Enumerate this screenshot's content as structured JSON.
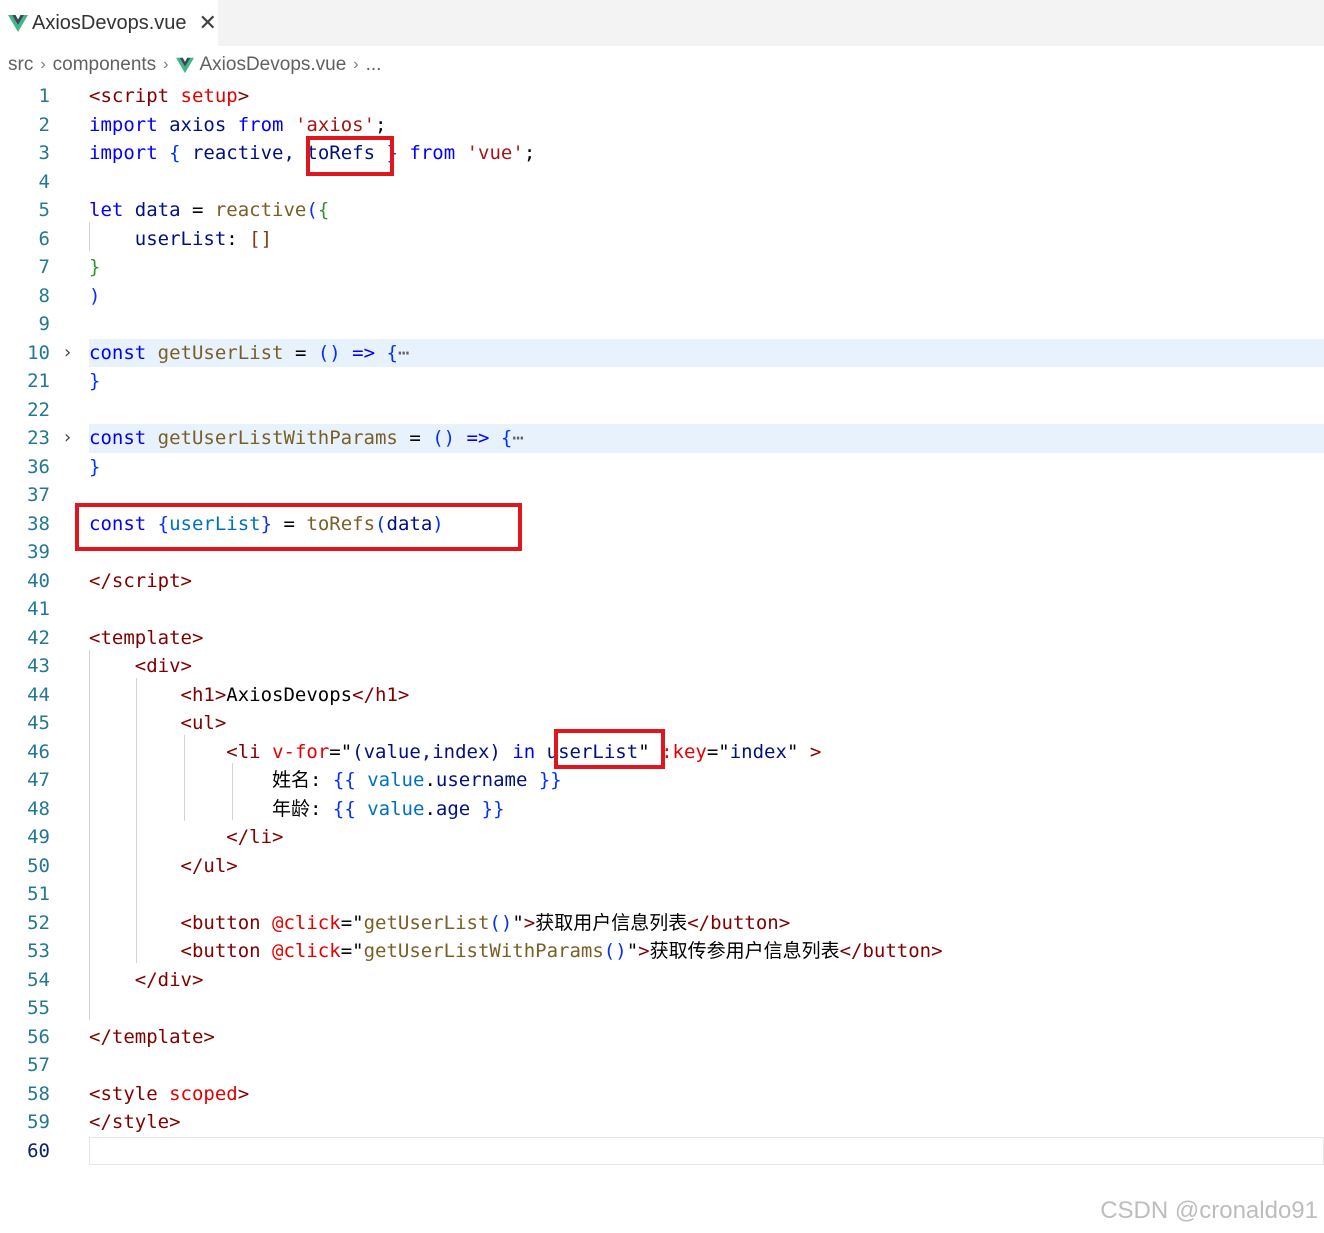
{
  "tab": {
    "label": "AxiosDevops.vue",
    "close": "✕"
  },
  "breadcrumb": {
    "items": [
      "src",
      "components",
      "AxiosDevops.vue",
      "..."
    ]
  },
  "editor": {
    "lines": [
      {
        "n": "1",
        "segs": [
          {
            "t": "<",
            "c": "tag"
          },
          {
            "t": "script",
            "c": "tag"
          },
          {
            "t": " setup",
            "c": "attr"
          },
          {
            "t": ">",
            "c": "tag"
          }
        ]
      },
      {
        "n": "2",
        "segs": [
          {
            "t": "import",
            "c": "kw"
          },
          {
            "t": " axios ",
            "c": "var"
          },
          {
            "t": "from",
            "c": "kw"
          },
          {
            "t": " ",
            "c": "plain"
          },
          {
            "t": "'axios'",
            "c": "str"
          },
          {
            "t": ";",
            "c": "plain"
          }
        ]
      },
      {
        "n": "3",
        "segs": [
          {
            "t": "import",
            "c": "kw"
          },
          {
            "t": " ",
            "c": "plain"
          },
          {
            "t": "{",
            "c": "br1"
          },
          {
            "t": " reactive, ",
            "c": "var"
          },
          {
            "t": "toRefs",
            "c": "var"
          },
          {
            "t": " ",
            "c": "plain"
          },
          {
            "t": "}",
            "c": "br1"
          },
          {
            "t": " ",
            "c": "plain"
          },
          {
            "t": "from",
            "c": "kw"
          },
          {
            "t": " ",
            "c": "plain"
          },
          {
            "t": "'vue'",
            "c": "str"
          },
          {
            "t": ";",
            "c": "plain"
          }
        ]
      },
      {
        "n": "4",
        "segs": []
      },
      {
        "n": "5",
        "segs": [
          {
            "t": "let",
            "c": "kw"
          },
          {
            "t": " data ",
            "c": "var"
          },
          {
            "t": "= ",
            "c": "plain"
          },
          {
            "t": "reactive",
            "c": "fn"
          },
          {
            "t": "(",
            "c": "br1"
          },
          {
            "t": "{",
            "c": "br2"
          }
        ]
      },
      {
        "n": "6",
        "segs": [
          {
            "t": "    userList",
            "c": "var"
          },
          {
            "t": ": ",
            "c": "plain"
          },
          {
            "t": "[]",
            "c": "br3"
          }
        ]
      },
      {
        "n": "7",
        "segs": [
          {
            "t": "}",
            "c": "br2"
          }
        ]
      },
      {
        "n": "8",
        "segs": [
          {
            "t": ")",
            "c": "br1"
          }
        ]
      },
      {
        "n": "9",
        "segs": []
      },
      {
        "n": "10",
        "fold": true,
        "segs": [
          {
            "t": "const",
            "c": "kw"
          },
          {
            "t": " ",
            "c": "plain"
          },
          {
            "t": "getUserList",
            "c": "fn"
          },
          {
            "t": " = ",
            "c": "plain"
          },
          {
            "t": "()",
            "c": "br1"
          },
          {
            "t": " ",
            "c": "plain"
          },
          {
            "t": "=>",
            "c": "kw"
          },
          {
            "t": " ",
            "c": "plain"
          },
          {
            "t": "{",
            "c": "br1"
          },
          {
            "t": "⋯",
            "c": "ell"
          }
        ]
      },
      {
        "n": "21",
        "segs": [
          {
            "t": "}",
            "c": "br1"
          }
        ]
      },
      {
        "n": "22",
        "segs": []
      },
      {
        "n": "23",
        "fold": true,
        "segs": [
          {
            "t": "const",
            "c": "kw"
          },
          {
            "t": " ",
            "c": "plain"
          },
          {
            "t": "getUserListWithParams",
            "c": "fn"
          },
          {
            "t": " = ",
            "c": "plain"
          },
          {
            "t": "()",
            "c": "br1"
          },
          {
            "t": " ",
            "c": "plain"
          },
          {
            "t": "=>",
            "c": "kw"
          },
          {
            "t": " ",
            "c": "plain"
          },
          {
            "t": "{",
            "c": "br1"
          },
          {
            "t": "⋯",
            "c": "ell"
          }
        ]
      },
      {
        "n": "36",
        "segs": [
          {
            "t": "}",
            "c": "br1"
          }
        ]
      },
      {
        "n": "37",
        "segs": []
      },
      {
        "n": "38",
        "segs": [
          {
            "t": "const",
            "c": "kw"
          },
          {
            "t": " ",
            "c": "plain"
          },
          {
            "t": "{",
            "c": "br1"
          },
          {
            "t": "userList",
            "c": "ref"
          },
          {
            "t": "}",
            "c": "br1"
          },
          {
            "t": " = ",
            "c": "plain"
          },
          {
            "t": "toRefs",
            "c": "fn"
          },
          {
            "t": "(",
            "c": "br1"
          },
          {
            "t": "data",
            "c": "var"
          },
          {
            "t": ")",
            "c": "br1"
          }
        ]
      },
      {
        "n": "39",
        "segs": []
      },
      {
        "n": "40",
        "segs": [
          {
            "t": "</",
            "c": "tag"
          },
          {
            "t": "script",
            "c": "tag"
          },
          {
            "t": ">",
            "c": "tag"
          }
        ]
      },
      {
        "n": "41",
        "segs": []
      },
      {
        "n": "42",
        "segs": [
          {
            "t": "<",
            "c": "tag"
          },
          {
            "t": "template",
            "c": "tag"
          },
          {
            "t": ">",
            "c": "tag"
          }
        ]
      },
      {
        "n": "43",
        "segs": [
          {
            "t": "    ",
            "c": "plain"
          },
          {
            "t": "<div>",
            "c": "tag"
          }
        ]
      },
      {
        "n": "44",
        "segs": [
          {
            "t": "        ",
            "c": "plain"
          },
          {
            "t": "<h1>",
            "c": "tag"
          },
          {
            "t": "AxiosDevops",
            "c": "plain"
          },
          {
            "t": "</h1>",
            "c": "tag"
          }
        ]
      },
      {
        "n": "45",
        "segs": [
          {
            "t": "        ",
            "c": "plain"
          },
          {
            "t": "<ul>",
            "c": "tag"
          }
        ]
      },
      {
        "n": "46",
        "segs": [
          {
            "t": "            ",
            "c": "plain"
          },
          {
            "t": "<li",
            "c": "tag"
          },
          {
            "t": " ",
            "c": "plain"
          },
          {
            "t": "v-for",
            "c": "attr"
          },
          {
            "t": "=\"",
            "c": "plain"
          },
          {
            "t": "(value,index)",
            "c": "var"
          },
          {
            "t": " ",
            "c": "plain"
          },
          {
            "t": "in",
            "c": "kw"
          },
          {
            "t": " ",
            "c": "plain"
          },
          {
            "t": "userList",
            "c": "var"
          },
          {
            "t": "\" ",
            "c": "plain"
          },
          {
            "t": ":key",
            "c": "attr"
          },
          {
            "t": "=\"",
            "c": "plain"
          },
          {
            "t": "index",
            "c": "var"
          },
          {
            "t": "\" ",
            "c": "plain"
          },
          {
            "t": ">",
            "c": "tag"
          }
        ]
      },
      {
        "n": "47",
        "segs": [
          {
            "t": "                姓名: ",
            "c": "plain"
          },
          {
            "t": "{{",
            "c": "br1"
          },
          {
            "t": " value",
            "c": "ref"
          },
          {
            "t": ".",
            "c": "plain"
          },
          {
            "t": "username",
            "c": "var"
          },
          {
            "t": " ",
            "c": "plain"
          },
          {
            "t": "}}",
            "c": "br1"
          }
        ]
      },
      {
        "n": "48",
        "segs": [
          {
            "t": "                年龄: ",
            "c": "plain"
          },
          {
            "t": "{{",
            "c": "br1"
          },
          {
            "t": " value",
            "c": "ref"
          },
          {
            "t": ".",
            "c": "plain"
          },
          {
            "t": "age",
            "c": "var"
          },
          {
            "t": " ",
            "c": "plain"
          },
          {
            "t": "}}",
            "c": "br1"
          }
        ]
      },
      {
        "n": "49",
        "segs": [
          {
            "t": "            ",
            "c": "plain"
          },
          {
            "t": "</li>",
            "c": "tag"
          }
        ]
      },
      {
        "n": "50",
        "segs": [
          {
            "t": "        ",
            "c": "plain"
          },
          {
            "t": "</ul>",
            "c": "tag"
          }
        ]
      },
      {
        "n": "51",
        "segs": []
      },
      {
        "n": "52",
        "segs": [
          {
            "t": "        ",
            "c": "plain"
          },
          {
            "t": "<button",
            "c": "tag"
          },
          {
            "t": " ",
            "c": "plain"
          },
          {
            "t": "@click",
            "c": "attr"
          },
          {
            "t": "=\"",
            "c": "plain"
          },
          {
            "t": "getUserList",
            "c": "fn"
          },
          {
            "t": "()",
            "c": "br1"
          },
          {
            "t": "\"",
            "c": "plain"
          },
          {
            "t": ">",
            "c": "tag"
          },
          {
            "t": "获取用户信息列表",
            "c": "plain"
          },
          {
            "t": "</button>",
            "c": "tag"
          }
        ]
      },
      {
        "n": "53",
        "segs": [
          {
            "t": "        ",
            "c": "plain"
          },
          {
            "t": "<button",
            "c": "tag"
          },
          {
            "t": " ",
            "c": "plain"
          },
          {
            "t": "@click",
            "c": "attr"
          },
          {
            "t": "=\"",
            "c": "plain"
          },
          {
            "t": "getUserListWithParams",
            "c": "fn"
          },
          {
            "t": "()",
            "c": "br1"
          },
          {
            "t": "\"",
            "c": "plain"
          },
          {
            "t": ">",
            "c": "tag"
          },
          {
            "t": "获取传参用户信息列表",
            "c": "plain"
          },
          {
            "t": "</button>",
            "c": "tag"
          }
        ]
      },
      {
        "n": "54",
        "segs": [
          {
            "t": "    ",
            "c": "plain"
          },
          {
            "t": "</div>",
            "c": "tag"
          }
        ]
      },
      {
        "n": "55",
        "segs": []
      },
      {
        "n": "56",
        "segs": [
          {
            "t": "</",
            "c": "tag"
          },
          {
            "t": "template",
            "c": "tag"
          },
          {
            "t": ">",
            "c": "tag"
          }
        ]
      },
      {
        "n": "57",
        "segs": []
      },
      {
        "n": "58",
        "segs": [
          {
            "t": "<",
            "c": "tag"
          },
          {
            "t": "style",
            "c": "tag"
          },
          {
            "t": " scoped",
            "c": "attr"
          },
          {
            "t": ">",
            "c": "tag"
          }
        ]
      },
      {
        "n": "59",
        "segs": [
          {
            "t": "</",
            "c": "tag"
          },
          {
            "t": "style",
            "c": "tag"
          },
          {
            "t": ">",
            "c": "tag"
          }
        ]
      },
      {
        "n": "60",
        "active": true,
        "segs": []
      }
    ]
  },
  "watermark": "CSDN @cronaldo91",
  "colors": {
    "highlight_box": "#e0161e",
    "fold_background": "#e8f2fc",
    "vue_green": "#41b883",
    "vue_dark": "#35495e"
  }
}
